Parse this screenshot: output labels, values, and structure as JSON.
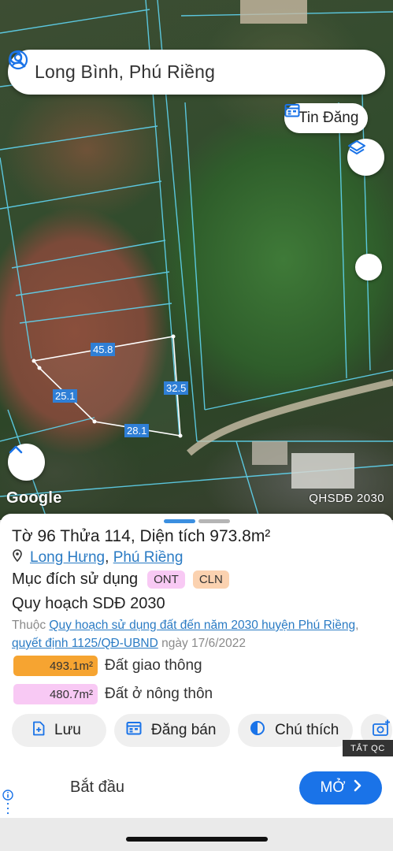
{
  "search": {
    "value": "Long Bình, Phú Riềng"
  },
  "map": {
    "listing_button_label": "Tin Đăng",
    "provider_logo": "Google",
    "layer_label": "QHSDĐ 2030",
    "edge_labels": [
      "45.8",
      "32.5",
      "25.1",
      "28.1"
    ],
    "colors": {
      "parcel_line": "#5fd4f0",
      "edge_label_bg": "#2f7fd6"
    },
    "icons": [
      "account-circle-icon",
      "search-icon",
      "calendar-icon",
      "layers-icon",
      "chevron-up-icon"
    ]
  },
  "parcel": {
    "to_label": "Tờ",
    "to_value": "96",
    "thua_label": "Thửa",
    "thua_value": "114,",
    "area_label": "Diện tích",
    "area_value": "973.8m²",
    "location_commune": "Long Hưng",
    "location_sep": ",",
    "location_district": "Phú Riềng",
    "purpose_label": "Mục đích sử dụng",
    "tags": [
      {
        "code": "ONT",
        "color": "#f8c9f4"
      },
      {
        "code": "CLN",
        "color": "#fbd2b0"
      }
    ],
    "plan_title": "Quy hoạch SDĐ 2030",
    "plan_prefix": "Thuộc",
    "plan_link": "Quy hoạch sử dụng đất đến năm 2030 huyện Phú Riềng",
    "plan_sep": ",",
    "decision_link": "quyết định 1125/QĐ-UBND",
    "date_text": "ngày 17/6/2022",
    "zones": [
      {
        "area": "493.1m²",
        "label": "Đất giao thông",
        "color": "#f6a431"
      },
      {
        "area": "480.7m²",
        "label": "Đất ở nông thôn",
        "color": "#f8c9f4"
      }
    ]
  },
  "actions": [
    {
      "label": "Lưu",
      "icon": "file-add-icon"
    },
    {
      "label": "Đăng bán",
      "icon": "calendar-icon"
    },
    {
      "label": "Chú thích",
      "icon": "contrast-icon"
    },
    {
      "label": "",
      "icon": "add-photo-icon"
    }
  ],
  "ad": {
    "close_label": "TẮT QC",
    "text": "Bắt đầu",
    "cta_label": "MỞ",
    "cta_color": "#1a73e8"
  }
}
